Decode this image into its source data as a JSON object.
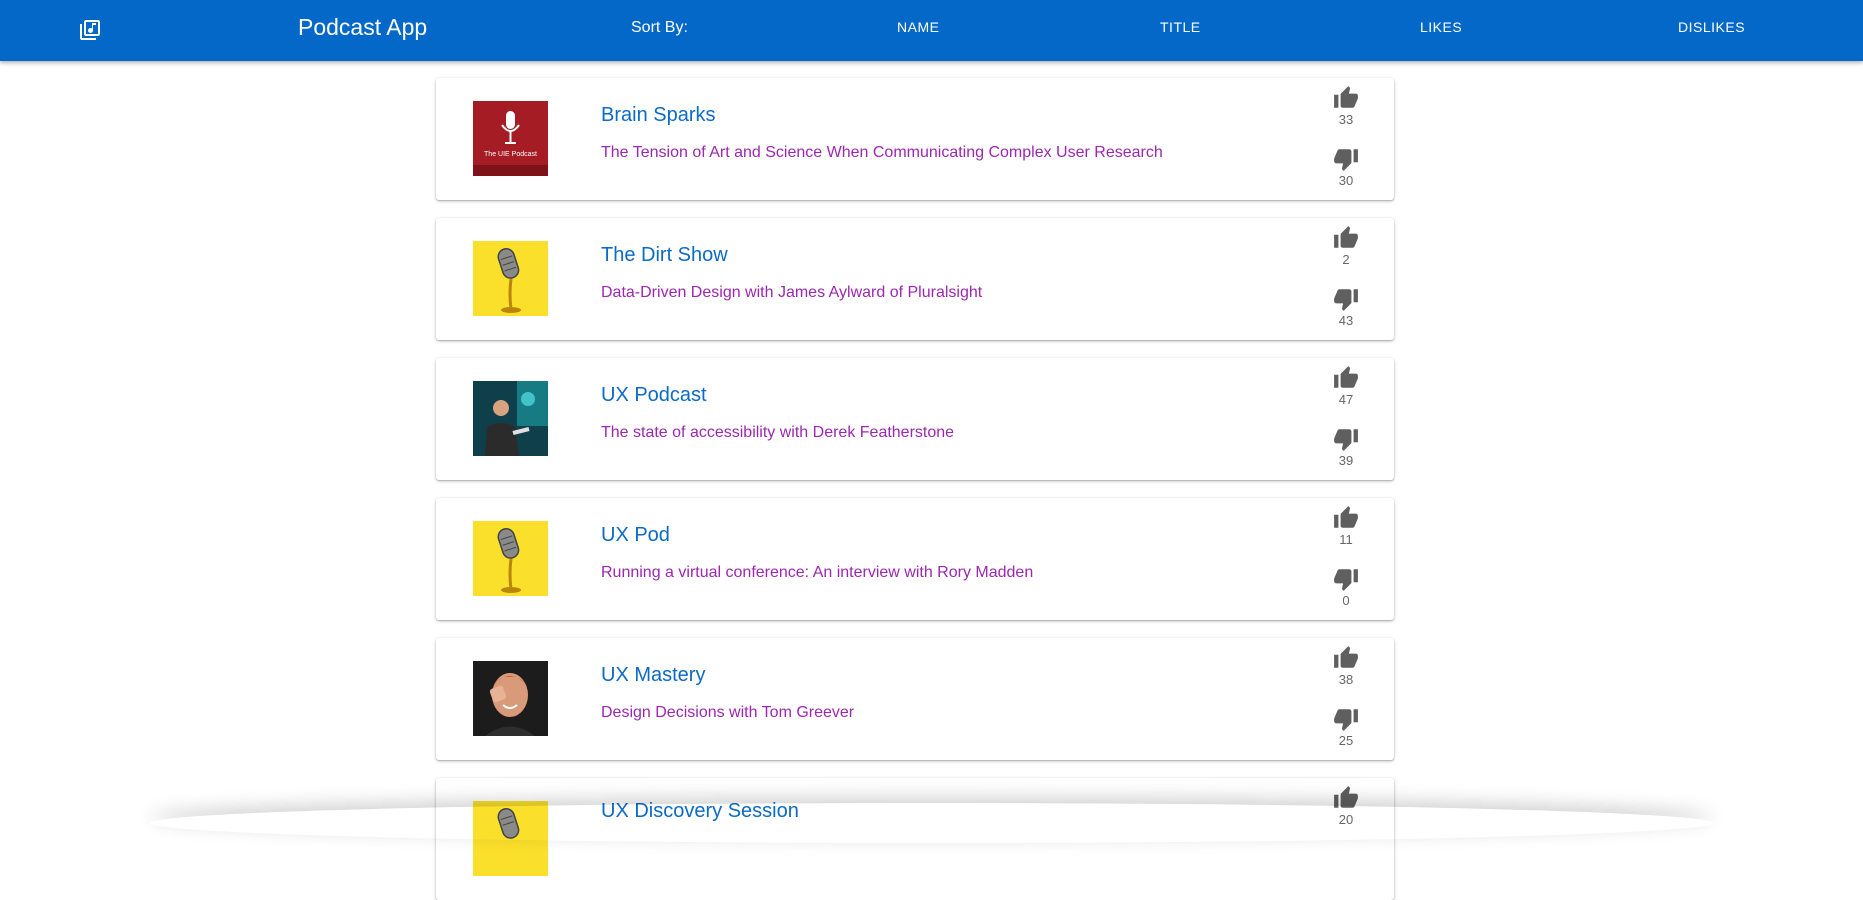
{
  "appbar": {
    "app_icon": "library-music-icon",
    "title": "Podcast App",
    "sort_label": "Sort By:",
    "sort_options": [
      "NAME",
      "TITLE",
      "LIKES",
      "DISLIKES"
    ]
  },
  "colors": {
    "appbar": "#0468c9",
    "podcast_name": "#0b6bc5",
    "episode_title": "#9c27b0",
    "vote_icon": "#5f5f5f"
  },
  "icons": {
    "like": "thumb-up-icon",
    "dislike": "thumb-down-icon"
  },
  "podcasts": [
    {
      "name": "Brain Sparks",
      "episode": "The Tension of Art and Science When Communicating Complex User Research",
      "likes": "33",
      "dislikes": "30",
      "thumb_text": "The UIE Podcast"
    },
    {
      "name": "The Dirt Show",
      "episode": "Data-Driven Design with James Aylward of Pluralsight",
      "likes": "2",
      "dislikes": "43"
    },
    {
      "name": "UX Podcast",
      "episode": "The state of accessibility with Derek Featherstone",
      "likes": "47",
      "dislikes": "39"
    },
    {
      "name": "UX Pod",
      "episode": "Running a virtual conference: An interview with Rory Madden",
      "likes": "11",
      "dislikes": "0"
    },
    {
      "name": "UX Mastery",
      "episode": "Design Decisions with Tom Greever",
      "likes": "38",
      "dislikes": "25"
    },
    {
      "name": "UX Discovery Session",
      "episode": "",
      "likes": "20",
      "dislikes": ""
    }
  ]
}
